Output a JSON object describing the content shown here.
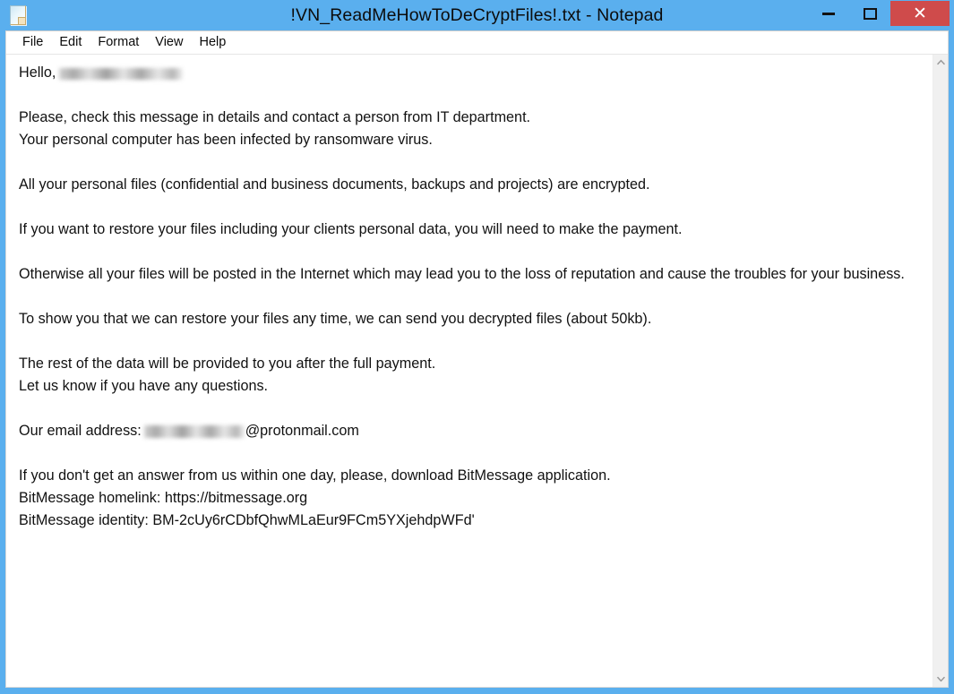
{
  "window": {
    "title": "!VN_ReadMeHowToDeCryptFiles!.txt - Notepad",
    "icon": "notepad-document-icon",
    "frame_color": "#5aafee",
    "controls": {
      "minimize_label": "—",
      "maximize_label": "☐",
      "close_label": "✕",
      "close_bg": "#cf4b4b"
    }
  },
  "menubar": {
    "items": [
      {
        "label": "File"
      },
      {
        "label": "Edit"
      },
      {
        "label": "Format"
      },
      {
        "label": "View"
      },
      {
        "label": "Help"
      }
    ]
  },
  "editor": {
    "lines": [
      {
        "type": "mixed",
        "prefix": "Hello,",
        "redacted": "name",
        "suffix": ""
      },
      {
        "type": "blank",
        "text": ""
      },
      {
        "type": "text",
        "text": "Please, check this message in details and contact a person from IT department."
      },
      {
        "type": "text",
        "text": "Your personal computer has been infected by ransomware virus."
      },
      {
        "type": "blank",
        "text": ""
      },
      {
        "type": "text",
        "text": "All your personal files (confidential and business documents, backups and projects) are encrypted."
      },
      {
        "type": "blank",
        "text": ""
      },
      {
        "type": "text",
        "text": "If you want to restore your files including your clients personal data, you will need to make the payment."
      },
      {
        "type": "blank",
        "text": ""
      },
      {
        "type": "text",
        "text": "Otherwise all your files will be posted in the Internet which may lead you to the loss of reputation and cause the troubles for your business."
      },
      {
        "type": "blank",
        "text": ""
      },
      {
        "type": "text",
        "text": "To show you that we can restore your files any time, we can send you decrypted files (about 50kb)."
      },
      {
        "type": "blank",
        "text": ""
      },
      {
        "type": "text",
        "text": "The rest of the data will be provided to you after the full payment."
      },
      {
        "type": "text",
        "text": "Let us know if you have any questions."
      },
      {
        "type": "blank",
        "text": ""
      },
      {
        "type": "mixed",
        "prefix": "Our email address:",
        "redacted": "email",
        "suffix": "@protonmail.com"
      },
      {
        "type": "blank",
        "text": ""
      },
      {
        "type": "text",
        "text": "If you don't get an answer from us within one day, please, download BitMessage application."
      },
      {
        "type": "text",
        "text": "BitMessage homelink: https://bitmessage.org"
      },
      {
        "type": "text",
        "text": "BitMessage identity: BM-2cUy6rCDbfQhwMLaEur9FCm5YXjehdpWFd'"
      }
    ]
  },
  "scrollbar": {
    "up_arrow": "chevron-up-icon",
    "down_arrow": "chevron-down-icon"
  }
}
